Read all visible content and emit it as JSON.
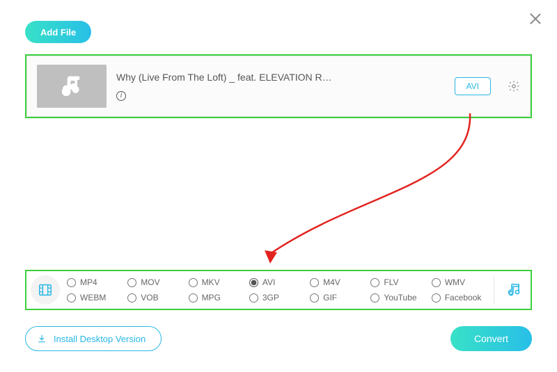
{
  "header": {
    "add_file_label": "Add File"
  },
  "file": {
    "title": "Why (Live From The Loft) _ feat. ELEVATION R…",
    "format_badge": "AVI"
  },
  "formats": {
    "row1": [
      {
        "label": "MP4",
        "selected": false
      },
      {
        "label": "MOV",
        "selected": false
      },
      {
        "label": "MKV",
        "selected": false
      },
      {
        "label": "AVI",
        "selected": true
      },
      {
        "label": "M4V",
        "selected": false
      },
      {
        "label": "FLV",
        "selected": false
      },
      {
        "label": "WMV",
        "selected": false
      }
    ],
    "row2": [
      {
        "label": "WEBM",
        "selected": false
      },
      {
        "label": "VOB",
        "selected": false
      },
      {
        "label": "MPG",
        "selected": false
      },
      {
        "label": "3GP",
        "selected": false
      },
      {
        "label": "GIF",
        "selected": false
      },
      {
        "label": "YouTube",
        "selected": false
      },
      {
        "label": "Facebook",
        "selected": false
      }
    ]
  },
  "footer": {
    "install_label": "Install Desktop Version",
    "convert_label": "Convert"
  },
  "annotations": {
    "file_card_highlight_color": "#3bd03b",
    "format_panel_highlight_color": "#3bd03b",
    "arrow_color": "#e2221f"
  }
}
